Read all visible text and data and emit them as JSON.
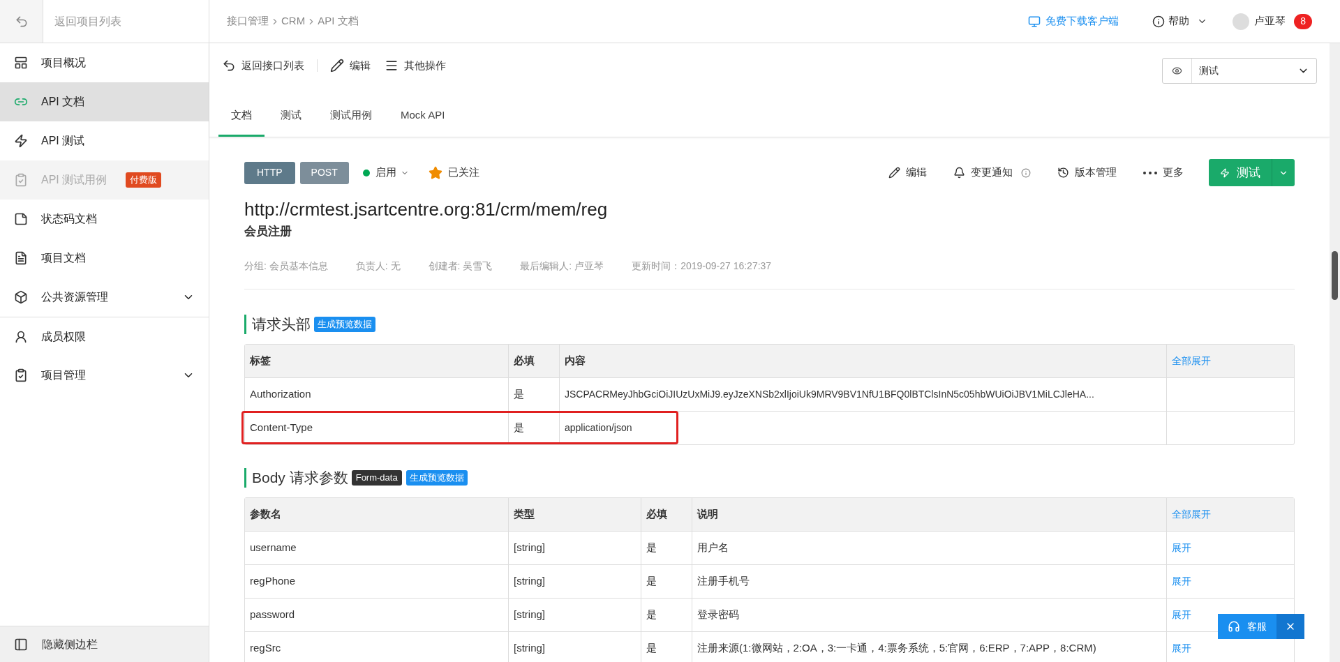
{
  "sidebar": {
    "back": "返回项目列表",
    "items": [
      {
        "label": "项目概况",
        "selected": false,
        "disabled": false
      },
      {
        "label": "API 文档",
        "selected": true,
        "disabled": false
      },
      {
        "label": "API 测试",
        "selected": false,
        "disabled": false
      },
      {
        "label": "API 测试用例",
        "selected": false,
        "disabled": true,
        "badge": "付费版"
      },
      {
        "label": "状态码文档",
        "selected": false,
        "disabled": false
      },
      {
        "label": "项目文档",
        "selected": false,
        "disabled": false
      },
      {
        "label": "公共资源管理",
        "selected": false,
        "disabled": false,
        "expanded": false
      },
      {
        "label": "成员权限",
        "selected": false,
        "disabled": false
      },
      {
        "label": "项目管理",
        "selected": false,
        "disabled": false,
        "expanded": false
      }
    ],
    "footer": "隐藏侧边栏"
  },
  "header": {
    "breadcrumb": [
      "接口管理",
      "CRM",
      "API 文档"
    ],
    "download": "免费下载客户端",
    "help": "帮助",
    "user": "卢亚琴",
    "notifications": "8"
  },
  "toolbar": {
    "actions": [
      "返回接口列表",
      "编辑",
      "其他操作"
    ],
    "environment": "测试"
  },
  "tabs": [
    {
      "label": "文档",
      "selected": true
    },
    {
      "label": "测试",
      "selected": false
    },
    {
      "label": "测试用例",
      "selected": false
    },
    {
      "label": "Mock API",
      "selected": false
    }
  ],
  "api": {
    "protocol": "HTTP",
    "method": "POST",
    "status": "启用",
    "status_enabled": true,
    "followed": true,
    "follow_label": "已关注",
    "actions": [
      "编辑",
      "变更通知",
      "版本管理",
      "更多"
    ],
    "test_button": "测试",
    "url": "http://crmtest.jsartcentre.org:81/crm/mem/reg",
    "name": "会员注册",
    "meta": [
      "分组: 会员基本信息",
      "负责人: 无",
      "创建者: 吴雪飞",
      "最后编辑人: 卢亚琴",
      "更新时间：2019-09-27 16:27:37"
    ]
  },
  "headers_section": {
    "title": "请求头部",
    "preview": "生成预览数据",
    "columns": [
      "标签",
      "必填",
      "内容",
      "全部展开"
    ],
    "rows": [
      {
        "name": "Authorization",
        "required": "是",
        "value": "JSCPACRMeyJhbGciOiJIUzUxMiJ9.eyJzeXNSb2xlIjoiUk9MRV9BV1NfU1BFQ0lBTClsInN5c05hbWUiOiJBV1MiLCJleHA...",
        "highlighted": false
      },
      {
        "name": "Content-Type",
        "required": "是",
        "value": "application/json",
        "highlighted": true
      }
    ]
  },
  "body_section": {
    "title": "Body 请求参数",
    "format": "Form-data",
    "preview": "生成预览数据",
    "columns": [
      "参数名",
      "类型",
      "必填",
      "说明",
      "全部展开"
    ],
    "rows": [
      {
        "name": "username",
        "type": "[string]",
        "required": "是",
        "description": "用户名",
        "action": "展开"
      },
      {
        "name": "regPhone",
        "type": "[string]",
        "required": "是",
        "description": "注册手机号",
        "action": "展开"
      },
      {
        "name": "password",
        "type": "[string]",
        "required": "是",
        "description": "登录密码",
        "action": "展开"
      },
      {
        "name": "regSrc",
        "type": "[string]",
        "required": "是",
        "description": "注册来源(1:微网站，2:OA，3:一卡通，4:票务系统，5:官网，6:ERP，7:APP，8:CRM)",
        "action": "展开"
      }
    ]
  },
  "support": {
    "label": "客服"
  }
}
